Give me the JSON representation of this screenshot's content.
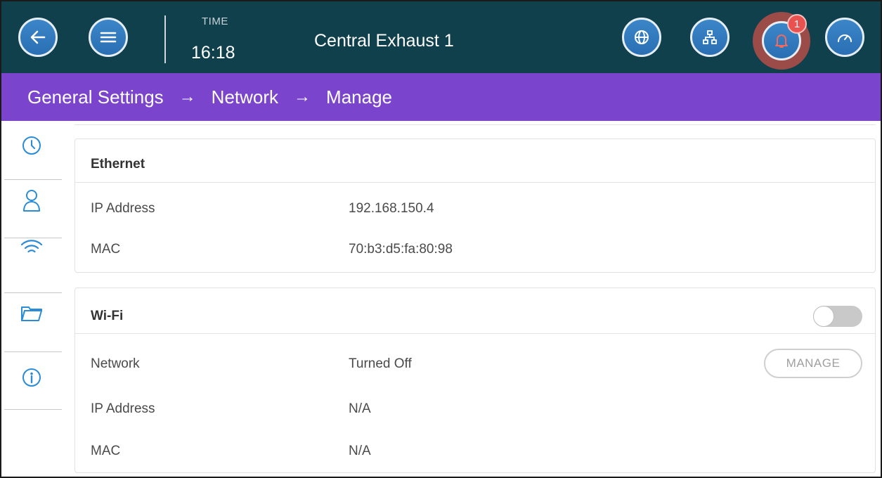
{
  "header": {
    "time_label": "TIME",
    "time_value": "16:18",
    "title": "Central Exhaust 1",
    "alarm_count": "1",
    "icons": [
      "back-arrow-icon",
      "menu-icon",
      "globe-icon",
      "network-icon",
      "bell-icon",
      "gauge-icon"
    ]
  },
  "breadcrumb": {
    "items": [
      "General Settings",
      "Network",
      "Manage"
    ],
    "separator": "→"
  },
  "sidebar": {
    "items": [
      {
        "icon": "clock-icon"
      },
      {
        "icon": "user-icon"
      },
      {
        "icon": "wifi-icon"
      },
      {
        "icon": "folder-icon"
      },
      {
        "icon": "info-icon"
      }
    ]
  },
  "ethernet": {
    "title": "Ethernet",
    "rows": [
      {
        "label": "IP Address",
        "value": "192.168.150.4"
      },
      {
        "label": "MAC",
        "value": "70:b3:d5:fa:80:98"
      }
    ]
  },
  "wifi": {
    "title": "Wi-Fi",
    "toggle_on": false,
    "manage_label": "MANAGE",
    "rows": [
      {
        "label": "Network",
        "value": "Turned Off"
      },
      {
        "label": "IP Address",
        "value": "N/A"
      },
      {
        "label": "MAC",
        "value": "N/A"
      }
    ]
  },
  "colors": {
    "header_bg": "#11404d",
    "breadcrumb_bg": "#7a45cc",
    "accent_blue": "#2a8bd6",
    "button_blue": "#2a6fb3",
    "alarm_ring": "#9b4c49",
    "badge_red": "#e9524f"
  }
}
